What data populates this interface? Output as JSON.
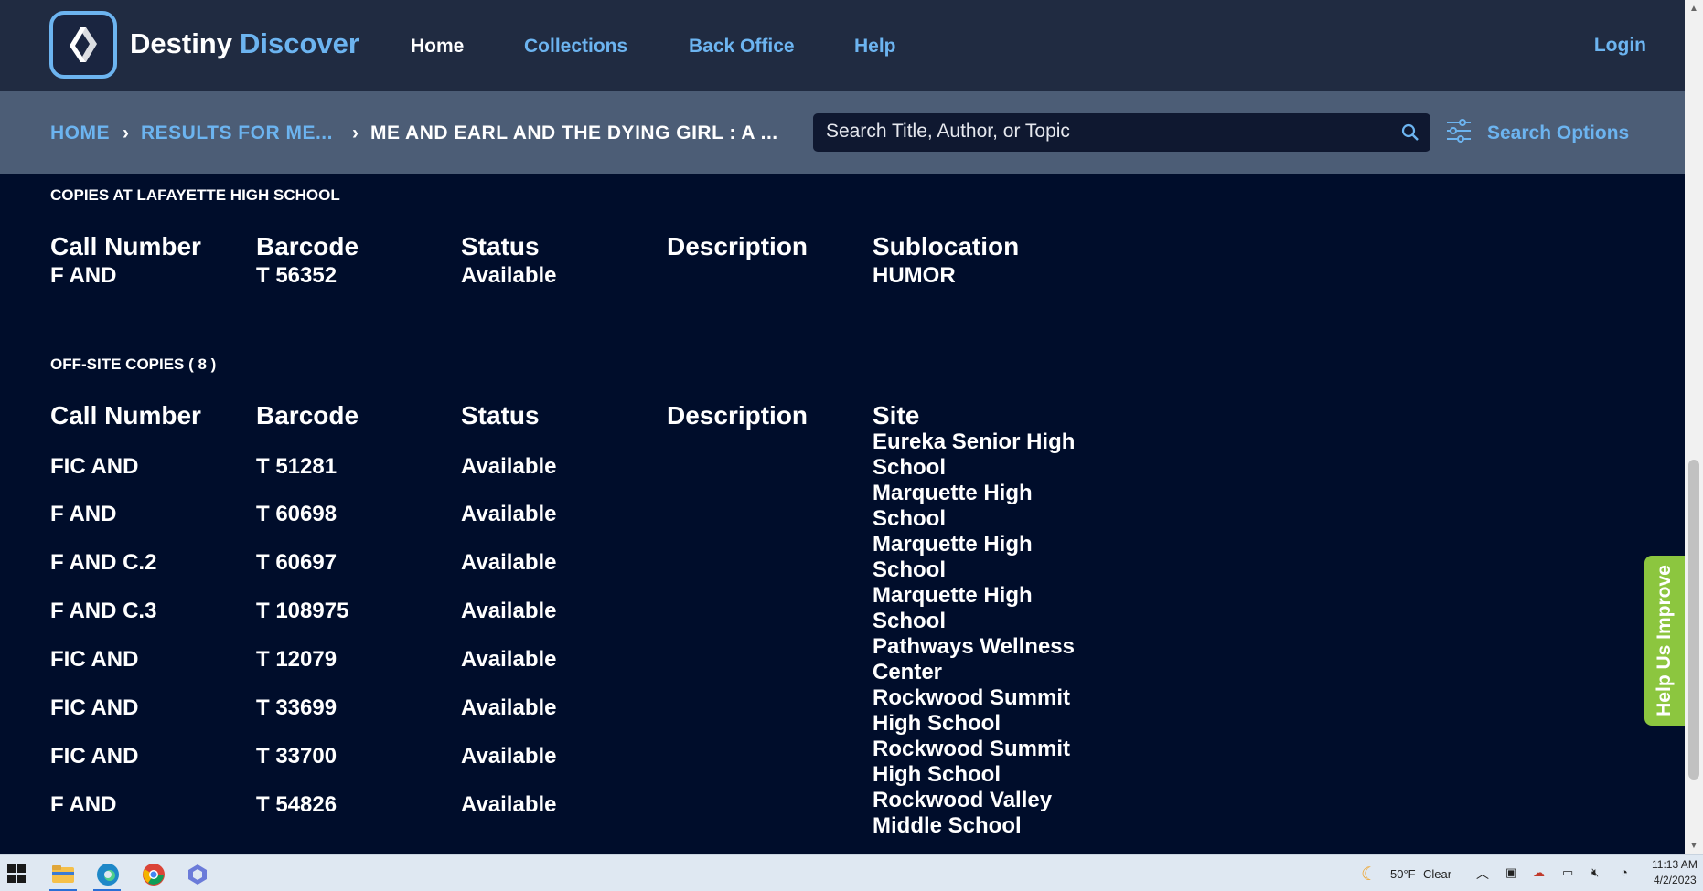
{
  "header": {
    "brand_part1": "Destiny",
    "brand_part2": "Discover",
    "nav": [
      "Home",
      "Collections",
      "Back Office",
      "Help"
    ],
    "login": "Login"
  },
  "breadcrumb": {
    "items": [
      "HOME",
      "RESULTS FOR ME...",
      "ME AND EARL AND THE DYING GIRL : A ..."
    ]
  },
  "search": {
    "placeholder": "Search Title, Author, or Topic",
    "options_label": "Search Options"
  },
  "local_copies": {
    "title": "COPIES AT LAFAYETTE HIGH SCHOOL",
    "headers": [
      "Call Number",
      "Barcode",
      "Status",
      "Description",
      "Sublocation"
    ],
    "rows": [
      {
        "call_number": "F AND",
        "barcode": "T 56352",
        "status": "Available",
        "description": "",
        "sublocation": "HUMOR"
      }
    ]
  },
  "offsite_copies": {
    "title": "OFF-SITE COPIES ( 8 )",
    "headers": [
      "Call Number",
      "Barcode",
      "Status",
      "Description",
      "Site"
    ],
    "rows": [
      {
        "call_number": "FIC AND",
        "barcode": "T 51281",
        "status": "Available",
        "site": "Eureka Senior High School"
      },
      {
        "call_number": "F AND",
        "barcode": "T 60698",
        "status": "Available",
        "site": "Marquette High School"
      },
      {
        "call_number": "F AND C.2",
        "barcode": "T 60697",
        "status": "Available",
        "site": "Marquette High School"
      },
      {
        "call_number": "F AND C.3",
        "barcode": "T 108975",
        "status": "Available",
        "site": "Marquette High School"
      },
      {
        "call_number": "FIC AND",
        "barcode": "T 12079",
        "status": "Available",
        "site": "Pathways Wellness Center"
      },
      {
        "call_number": "FIC AND",
        "barcode": "T 33699",
        "status": "Available",
        "site": "Rockwood Summit High School"
      },
      {
        "call_number": "FIC AND",
        "barcode": "T 33700",
        "status": "Available",
        "site": "Rockwood Summit High School"
      },
      {
        "call_number": "F AND",
        "barcode": "T 54826",
        "status": "Available",
        "site": "Rockwood Valley Middle School"
      }
    ]
  },
  "feedback_tab": "Help Us Improve",
  "taskbar": {
    "weather": "50°F",
    "weather_desc": "Clear",
    "time": "11:13 AM",
    "date": "4/2/2023"
  },
  "colors": {
    "topbar": "#202b41",
    "subbar": "#4c5d76",
    "content_bg": "#000d2b",
    "accent": "#6cb4f0",
    "feedback": "#8cc63f"
  }
}
